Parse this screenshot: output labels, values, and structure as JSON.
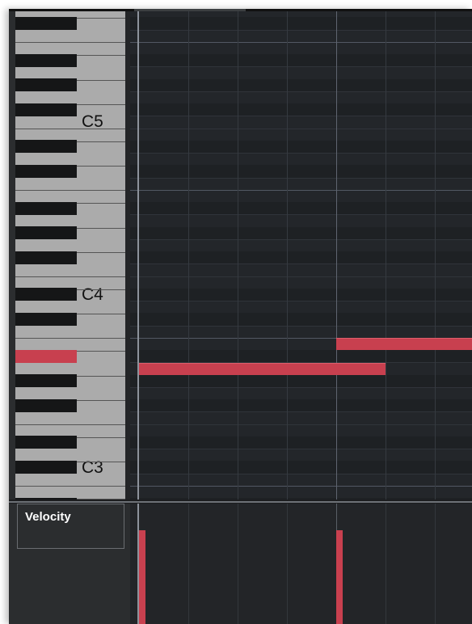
{
  "window": {
    "name": "piano-roll-editor"
  },
  "keyboard": {
    "octave_labels": [
      "C5",
      "C4",
      "C3"
    ],
    "active_key": "A#3"
  },
  "notes": [
    {
      "pitch": "A3",
      "start_step": 0,
      "length_steps": 5
    },
    {
      "pitch": "B3",
      "start_step": 4,
      "length_steps": 3
    }
  ],
  "velocity_lane": {
    "label": "Velocity",
    "bars": [
      {
        "step": 0,
        "velocity": 0.78
      },
      {
        "step": 4,
        "velocity": 0.78
      }
    ]
  },
  "colors": {
    "note": "#c8404f",
    "grid_bg": "#23262a",
    "keyboard_white": "#ababab",
    "keyboard_black": "#151617"
  }
}
